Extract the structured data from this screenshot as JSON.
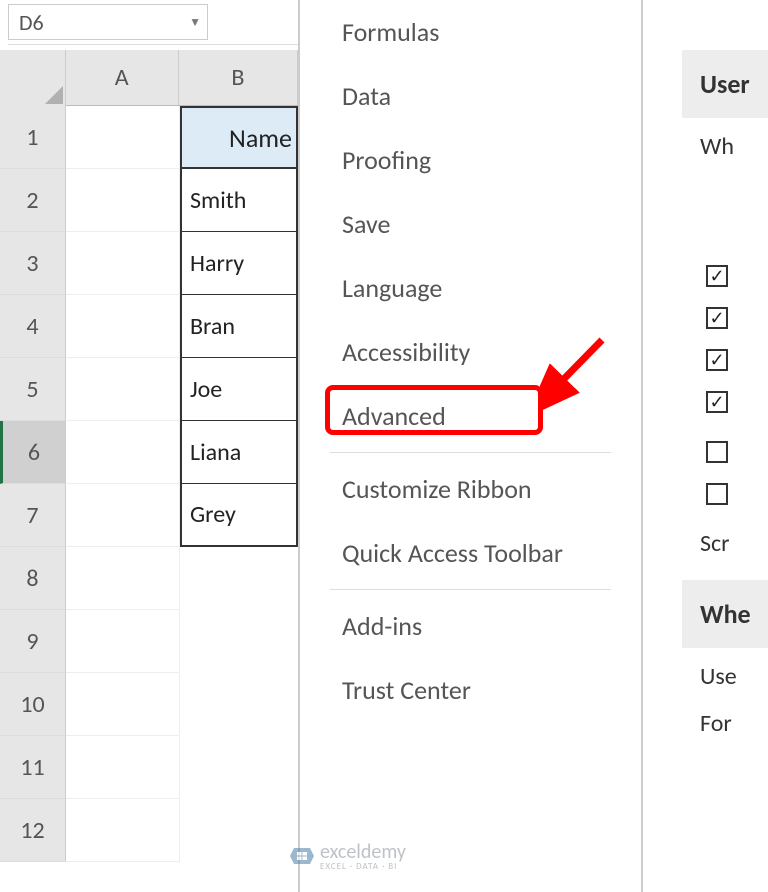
{
  "name_box": {
    "value": "D6"
  },
  "columns": {
    "a": "A",
    "b": "B"
  },
  "rows": [
    "1",
    "2",
    "3",
    "4",
    "5",
    "6",
    "7",
    "8",
    "9",
    "10",
    "11",
    "12"
  ],
  "table": {
    "header": "Name",
    "data": [
      "Smith",
      "Harry",
      "Bran",
      "Joe",
      "Liana",
      "Grey"
    ]
  },
  "options": {
    "items": [
      "Formulas",
      "Data",
      "Proofing",
      "Save",
      "Language",
      "Accessibility",
      "Advanced",
      "Customize Ribbon",
      "Quick Access Toolbar",
      "Add-ins",
      "Trust Center"
    ]
  },
  "right": {
    "section1": "User",
    "text1": "Wh",
    "checks": [
      true,
      true,
      true,
      true,
      false,
      false
    ],
    "text2": "Scr",
    "section2": "Whe",
    "text3": "Use",
    "text4": "For"
  },
  "watermark": {
    "name": "exceldemy",
    "sub": "EXCEL · DATA · BI"
  },
  "highlight_color": "#ff0000"
}
